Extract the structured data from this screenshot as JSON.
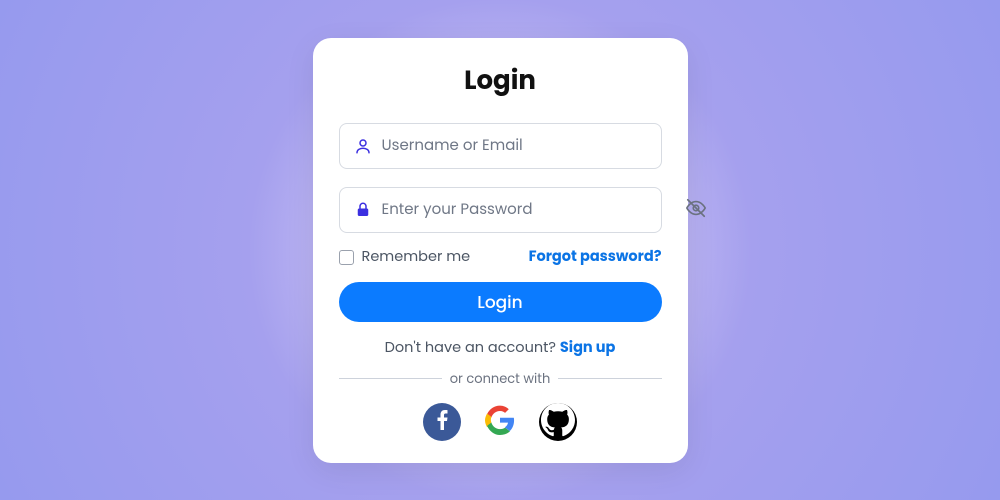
{
  "title": "Login",
  "fields": {
    "username": {
      "placeholder": "Username or Email",
      "value": ""
    },
    "password": {
      "placeholder": "Enter your Password",
      "value": ""
    }
  },
  "remember_label": "Remember me",
  "forgot_label": "Forgot password?",
  "login_button": "Login",
  "signup_prompt": "Don't have an account? ",
  "signup_link": "Sign up",
  "divider_text": "or connect with",
  "social": {
    "facebook": "facebook",
    "google": "google",
    "github": "github"
  }
}
